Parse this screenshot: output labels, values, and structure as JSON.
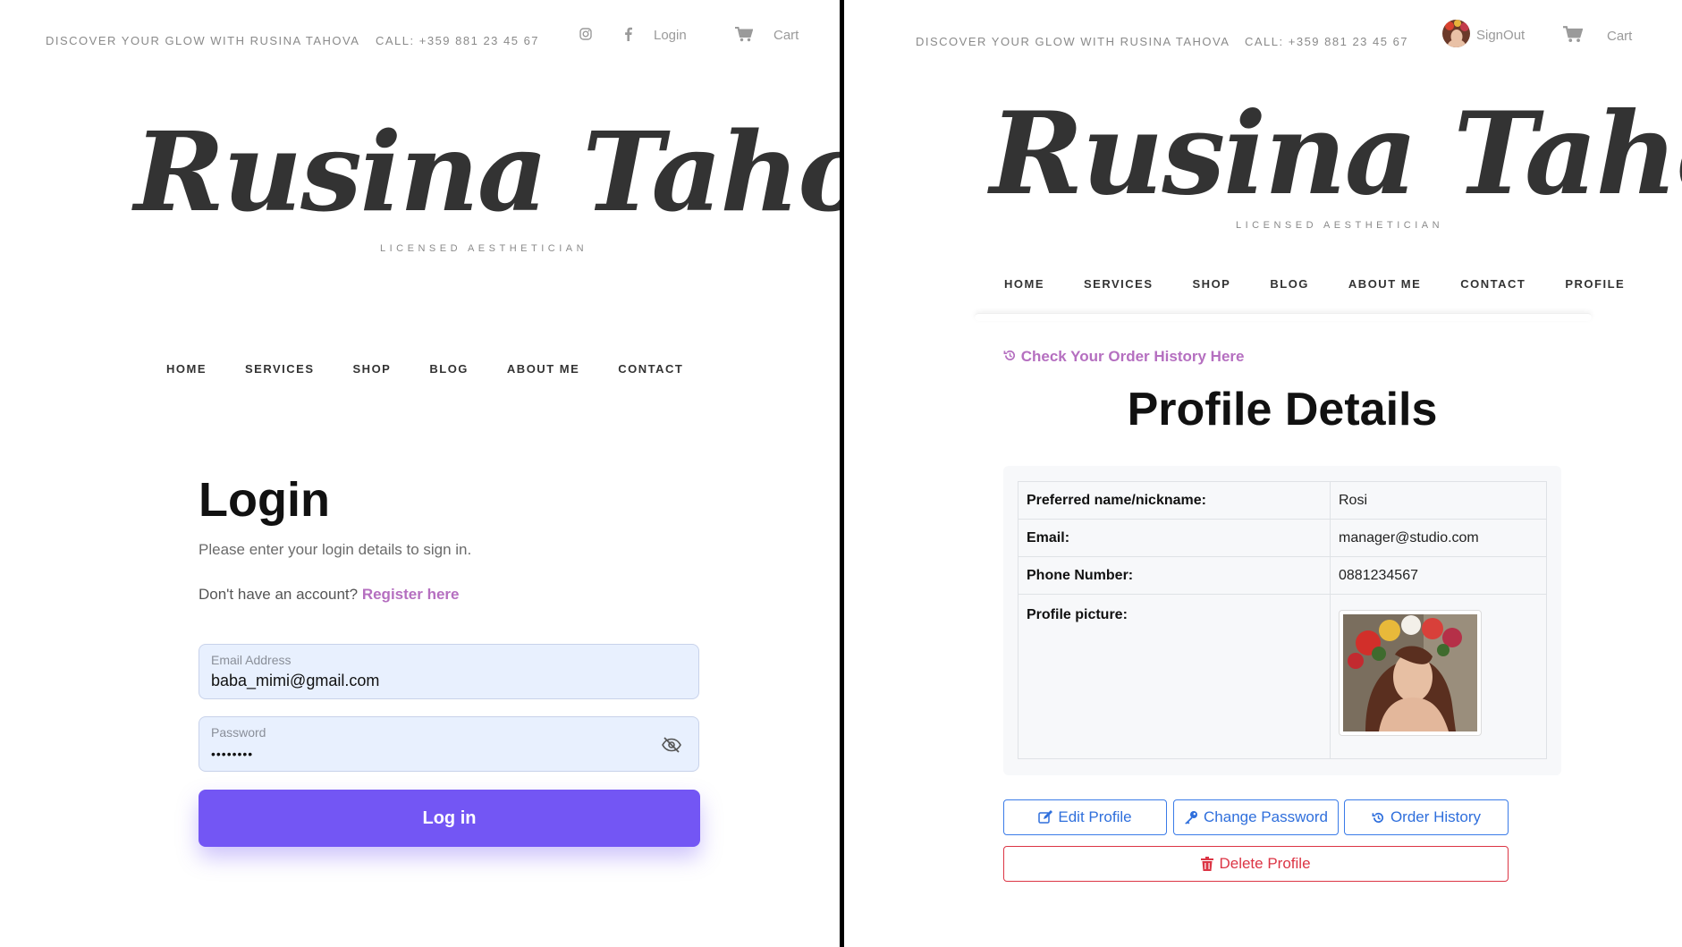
{
  "left": {
    "topbar": {
      "tagline": "DISCOVER YOUR GLOW WITH RUSINA TAHOVA",
      "phone": "CALL: +359 881 23 45 67",
      "login_link": "Login",
      "cart_link": "Cart",
      "icons": [
        "instagram-icon",
        "facebook-icon",
        "cart-icon"
      ]
    },
    "logo": {
      "title": "Rusina Tahova",
      "subtitle": "LICENSED AESTHETICIAN"
    },
    "nav": [
      "HOME",
      "SERVICES",
      "SHOP",
      "BLOG",
      "ABOUT ME",
      "CONTACT"
    ],
    "login": {
      "title": "Login",
      "description": "Please enter your login details to sign in.",
      "register_prompt": "Don't have an account?",
      "register_link": "Register here",
      "email_label": "Email Address",
      "email_value": "baba_mimi@gmail.com",
      "password_label": "Password",
      "password_value": "••••••••",
      "submit_label": "Log in"
    }
  },
  "right": {
    "topbar": {
      "tagline": "DISCOVER YOUR GLOW WITH RUSINA TAHOVA",
      "phone": "CALL: +359 881 23 45 67",
      "signout_link": "SignOut",
      "cart_link": "Cart"
    },
    "logo": {
      "title": "Rusina Tahova",
      "subtitle": "LICENSED AESTHETICIAN"
    },
    "nav": [
      "HOME",
      "SERVICES",
      "SHOP",
      "BLOG",
      "ABOUT ME",
      "CONTACT",
      "PROFILE"
    ],
    "profile": {
      "history_link": "Check Your Order History Here",
      "heading": "Profile Details",
      "rows": [
        {
          "label": "Preferred name/nickname:",
          "value": "Rosi"
        },
        {
          "label": "Email:",
          "value": "manager@studio.com"
        },
        {
          "label": "Phone Number:",
          "value": "0881234567"
        },
        {
          "label": "Profile picture:",
          "value": ""
        }
      ],
      "buttons": {
        "edit": "Edit Profile",
        "change_password": "Change Password",
        "order_history": "Order History",
        "delete": "Delete Profile"
      }
    }
  },
  "colors": {
    "accent_purple": "#7356f4",
    "link_pink": "#b56fc0",
    "button_blue": "#2f6fdc",
    "danger_red": "#dc3545",
    "input_bg": "#e8f0fe"
  }
}
